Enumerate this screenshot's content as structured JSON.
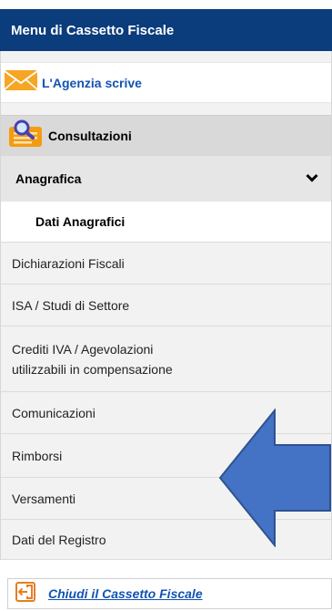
{
  "header": {
    "title": "Menu di Cassetto Fiscale"
  },
  "agenzia": {
    "label": "L'Agenzia scrive",
    "icon": "mail-envelope-icon"
  },
  "consultazioni": {
    "label": "Consultazioni",
    "icon": "search-document-icon"
  },
  "anagrafica": {
    "label": "Anagrafica",
    "icon": "chevron-down-icon"
  },
  "dati_anagrafici": {
    "label": "Dati Anagrafici"
  },
  "items": [
    {
      "label": "Dichiarazioni Fiscali"
    },
    {
      "label": "ISA / Studi di Settore"
    },
    {
      "label_line1": "Crediti IVA / Agevolazioni",
      "label_line2": "utilizzabili in compensazione"
    },
    {
      "label": "Comunicazioni"
    },
    {
      "label": "Rimborsi"
    },
    {
      "label": "Versamenti"
    },
    {
      "label": "Dati del Registro"
    }
  ],
  "footer": {
    "label": "Chiudi il Cassetto Fiscale",
    "icon": "exit-icon"
  },
  "colors": {
    "header_bg": "#0b3c7b",
    "link": "#1153b3",
    "arrow": "#4472c4"
  }
}
